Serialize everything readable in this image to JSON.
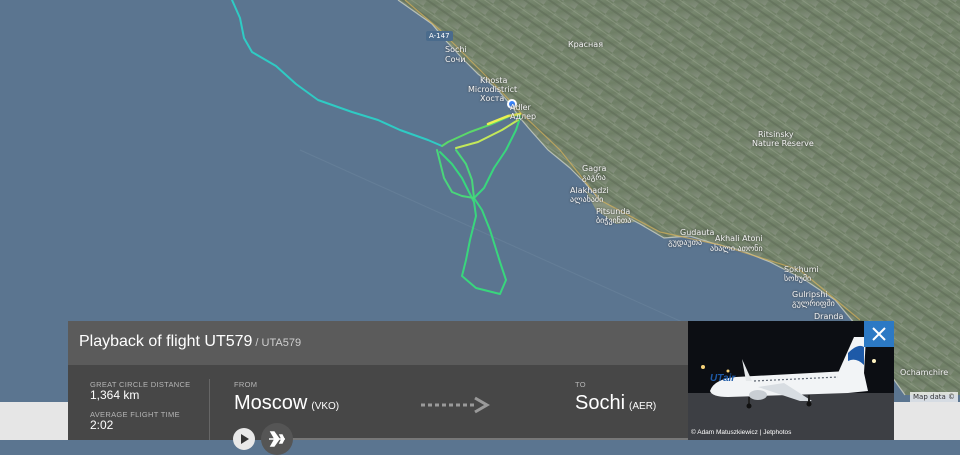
{
  "map": {
    "road_badge": "A-147",
    "labels": {
      "sochi_en": "Sochi",
      "sochi_ru": "Сочи",
      "khosta_en": "Khosta",
      "khosta_district": "Microdistrict",
      "khosta_ru": "Хоста",
      "adler_en": "Adler",
      "adler_ru": "Адлер",
      "gagra_en": "Gagra",
      "gagra_ka": "გაგრა",
      "alakhadzi_en": "Alakhadzi",
      "alakhadzi_ka": "ალახაძი",
      "pitsunda_en": "Pitsunda",
      "pitsunda_ka": "ბიჭვინთა",
      "gudauta_en": "Gudauta",
      "gudauta_ka": "გუდაუთა",
      "akhali_atoni_en": "Akhali Atoni",
      "akhali_atoni_ka": "ახალი ათონი",
      "sokhumi_en": "Sokhumi",
      "sokhumi_ka": "სოხუმი",
      "gulripshi_en": "Gulripshi",
      "gulripshi_ka": "გულრიფში",
      "dranda": "Dranda",
      "park_line1": "Ritsinsky",
      "park_line2": "Nature Reserve",
      "krasnaya": "Красная",
      "ochamchire": "Ochamchire"
    },
    "attribution": "Map data ©"
  },
  "panel": {
    "title": "Playback of flight UT579",
    "callsign": "/ UTA579",
    "distance_label": "GREAT CIRCLE DISTANCE",
    "distance_value": "1,364 km",
    "time_label": "AVERAGE FLIGHT TIME",
    "time_value": "2:02",
    "from_label": "FROM",
    "from_city": "Moscow",
    "from_code": "(VKO)",
    "to_label": "TO",
    "to_city": "Sochi",
    "to_code": "(AER)"
  },
  "photo": {
    "credit": "© Adam Matuszkiewicz | Jetphotos",
    "livery_text": "UTair"
  },
  "icons": {
    "close": "close-icon",
    "play": "play-icon",
    "plane": "plane-icon"
  },
  "colors": {
    "sea": "#5b7590",
    "track_start": "#29c6d6",
    "track_mid": "#3fd86b",
    "track_end": "#e8f04a",
    "accent_close": "#2c79c4"
  }
}
